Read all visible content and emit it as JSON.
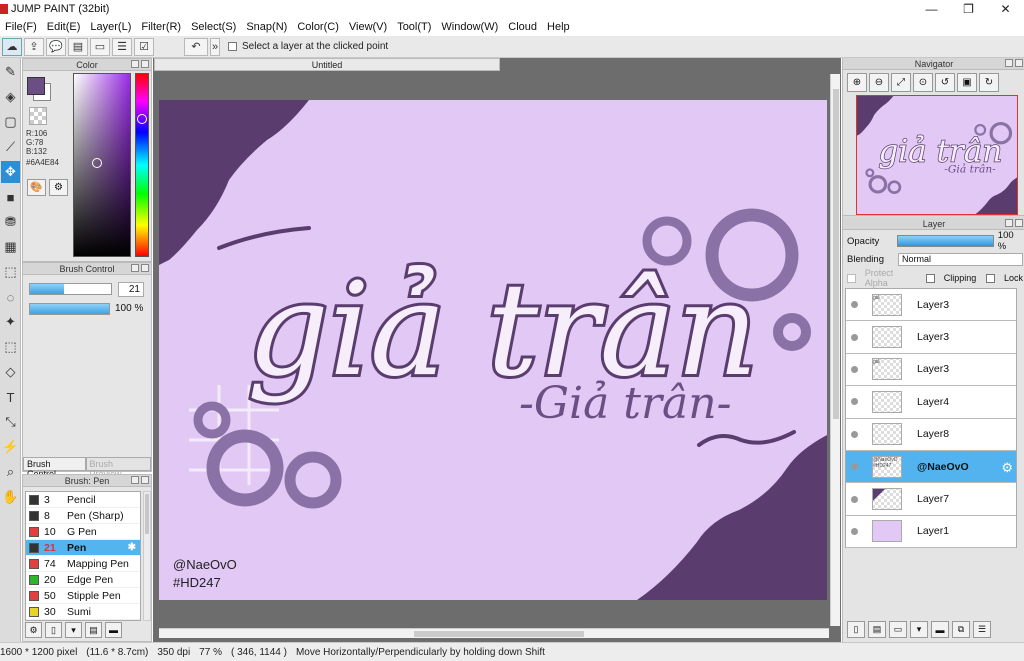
{
  "window": {
    "title": "JUMP PAINT (32bit)",
    "minimize": "—",
    "maximize": "❐",
    "close": "✕"
  },
  "menu": [
    "File(F)",
    "Edit(E)",
    "Layer(L)",
    "Filter(R)",
    "Select(S)",
    "Snap(N)",
    "Color(C)",
    "View(V)",
    "Tool(T)",
    "Window(W)",
    "Cloud",
    "Help"
  ],
  "toolbar": {
    "select_layer_label": "Select a layer at the clicked point"
  },
  "color_panel": {
    "title": "Color",
    "r": "R:106",
    "g": "G:78",
    "b": "B:132",
    "hex": "#6A4E84",
    "current_color": "#6a4e84"
  },
  "brush_control": {
    "title": "Brush Control",
    "size_value": "21",
    "size_fraction": 0.42,
    "opacity": "100 %",
    "tab_active": "Brush Control",
    "tab_inactive": "Brush Preview"
  },
  "brush_panel": {
    "title": "Brush: Pen",
    "items": [
      {
        "size": "3",
        "name": "Pencil",
        "color": "#333333"
      },
      {
        "size": "8",
        "name": "Pen (Sharp)",
        "color": "#333333"
      },
      {
        "size": "10",
        "name": "G Pen",
        "color": "#e24040"
      },
      {
        "size": "21",
        "name": "Pen",
        "color": "#333333"
      },
      {
        "size": "74",
        "name": "Mapping Pen",
        "color": "#e24040"
      },
      {
        "size": "20",
        "name": "Edge Pen",
        "color": "#2db52d"
      },
      {
        "size": "50",
        "name": "Stipple Pen",
        "color": "#e24040"
      },
      {
        "size": "30",
        "name": "Sumi",
        "color": "#e8d22c"
      }
    ],
    "selected": "Pen"
  },
  "canvas": {
    "tab": "Untitled",
    "title_main": "giả trân",
    "title_sub": "-Giả trân-",
    "credit_1": "@NaeOvO",
    "credit_2": "#HD247",
    "bg_color": "#e2c8f5",
    "accent_color": "#5a3d6e",
    "circle_color": "#8a72a6"
  },
  "navigator": {
    "title": "Navigator"
  },
  "layer_panel": {
    "title": "Layer",
    "opacity_label": "Opacity",
    "opacity_value": "100 %",
    "blending_label": "Blending",
    "blending_value": "Normal",
    "protect_alpha": "Protect Alpha",
    "clipping": "Clipping",
    "lock": "Lock",
    "layers": [
      {
        "name": "Layer3",
        "thumb": "giả"
      },
      {
        "name": "Layer3",
        "thumb": ""
      },
      {
        "name": "Layer3",
        "thumb": "giả"
      },
      {
        "name": "Layer4",
        "thumb": ""
      },
      {
        "name": "Layer8",
        "thumb": ""
      },
      {
        "name": "@NaeOvO",
        "thumb": "@NaeOvO #HD247"
      },
      {
        "name": "Layer7",
        "thumb": ""
      },
      {
        "name": "Layer1",
        "thumb": ""
      }
    ],
    "selected": "@NaeOvO"
  },
  "status": {
    "size": "1600 * 1200 pixel",
    "physical": "(11.6 * 8.7cm)",
    "dpi": "350 dpi",
    "zoom": "77 %",
    "coords": "( 346, 1144 )",
    "hint": "Move Horizontally/Perpendicularly by holding down Shift"
  }
}
